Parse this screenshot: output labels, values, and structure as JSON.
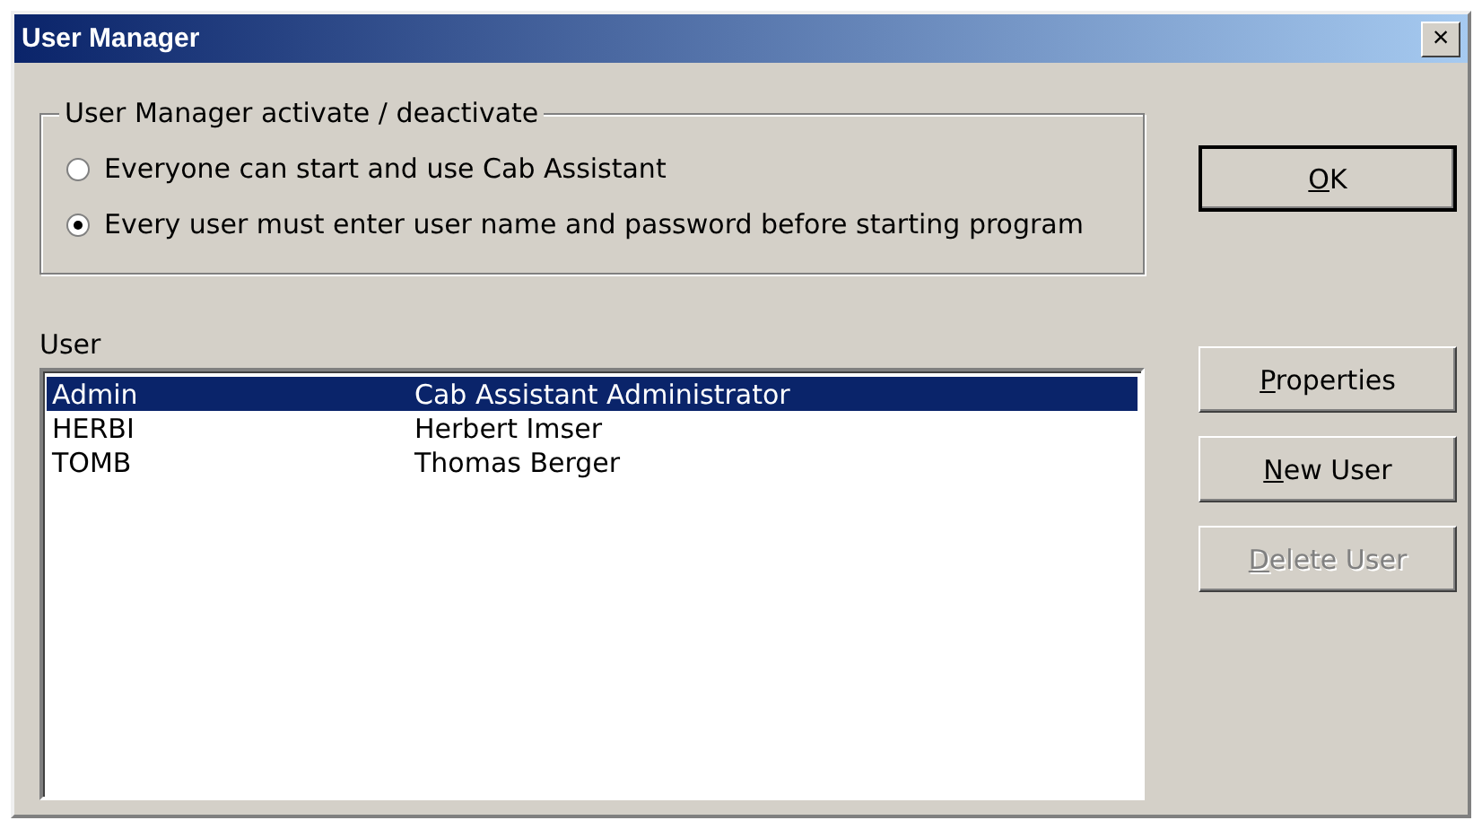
{
  "window": {
    "title": "User Manager",
    "close": "×"
  },
  "group": {
    "title": "User Manager activate / deactivate",
    "options": [
      {
        "label": "Everyone can start and use Cab Assistant",
        "selected": false
      },
      {
        "label": "Every user must enter user name and password before starting program",
        "selected": true
      }
    ]
  },
  "list": {
    "label": "User",
    "rows": [
      {
        "name": "Admin",
        "full_name": "Cab Assistant Administrator",
        "selected": true
      },
      {
        "name": "HERBI",
        "full_name": "Herbert Imser",
        "selected": false
      },
      {
        "name": "TOMB",
        "full_name": "Thomas Berger",
        "selected": false
      }
    ]
  },
  "buttons": [
    {
      "label": "OK",
      "disabled": false,
      "mnemonic": true
    },
    {
      "label": "Properties",
      "disabled": false,
      "mnemonic": true
    },
    {
      "label": "New User",
      "disabled": false,
      "mnemonic": true
    },
    {
      "label": "Delete User",
      "disabled": true,
      "mnemonic": true
    }
  ]
}
